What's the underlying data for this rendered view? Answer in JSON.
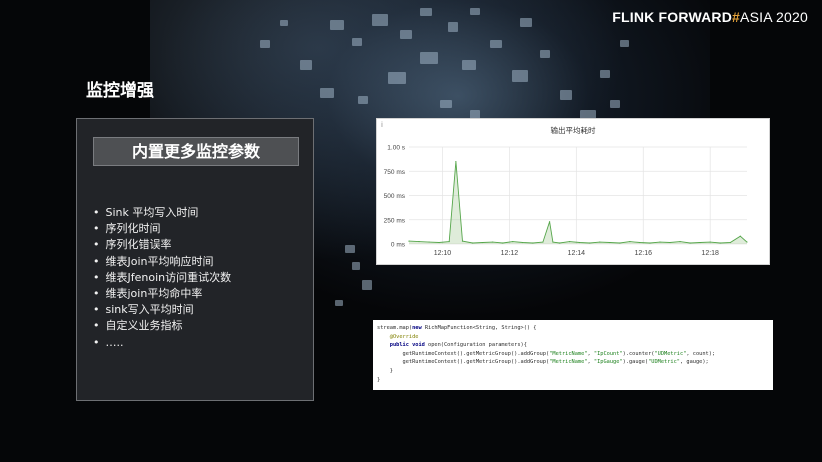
{
  "brand": {
    "name": "FLINK FORWARD",
    "hash": "#",
    "event": "ASIA 2020"
  },
  "section_title": "监控增强",
  "panel": {
    "header": "内置更多监控参数",
    "items": [
      "Sink 平均写入时间",
      "序列化时间",
      "序列化错误率",
      "维表Join平均响应时间",
      "维表Jfenoin访问重试次数",
      "维表join平均命中率",
      "sink写入平均时间",
      "自定义业务指标",
      "….."
    ]
  },
  "chart": {
    "info_icon": "i",
    "title": "输出平均耗时"
  },
  "chart_data": {
    "type": "area",
    "title": "输出平均耗时",
    "xlabel": "",
    "ylabel": "",
    "yticks": [
      "0 ms",
      "250 ms",
      "500 ms",
      "750 ms",
      "1.00 s"
    ],
    "xticks": [
      "12:10",
      "12:12",
      "12:14",
      "12:16",
      "12:18"
    ],
    "ylim": [
      0,
      1000
    ],
    "grid": true,
    "x": [
      "12:09.0",
      "12:09.3",
      "12:09.6",
      "12:09.9",
      "12:10.2",
      "12:10.4",
      "12:10.6",
      "12:10.9",
      "12:11.2",
      "12:11.5",
      "12:11.8",
      "12:12.1",
      "12:12.4",
      "12:12.7",
      "12:13.0",
      "12:13.2",
      "12:13.3",
      "12:13.5",
      "12:13.8",
      "12:14.1",
      "12:14.4",
      "12:14.7",
      "12:15.0",
      "12:15.3",
      "12:15.6",
      "12:15.9",
      "12:16.2",
      "12:16.5",
      "12:16.8",
      "12:17.1",
      "12:17.4",
      "12:17.7",
      "12:18.0",
      "12:18.3",
      "12:18.6",
      "12:18.9",
      "12:19.1"
    ],
    "values": [
      30,
      25,
      20,
      15,
      25,
      850,
      30,
      10,
      15,
      20,
      10,
      25,
      15,
      10,
      20,
      230,
      20,
      10,
      25,
      15,
      10,
      20,
      15,
      10,
      25,
      15,
      10,
      20,
      15,
      25,
      10,
      15,
      20,
      10,
      15,
      80,
      20
    ]
  },
  "code": {
    "lines": [
      [
        {
          "t": "stream.map(",
          "c": ""
        },
        {
          "t": "new ",
          "c": "kw"
        },
        {
          "t": "RichMapFunction<String, String>() {",
          "c": ""
        }
      ],
      [
        {
          "t": "    ",
          "c": ""
        },
        {
          "t": "@Override",
          "c": "ann"
        }
      ],
      [
        {
          "t": "    ",
          "c": ""
        },
        {
          "t": "public void ",
          "c": "kw"
        },
        {
          "t": "open(Configuration parameters){",
          "c": ""
        }
      ],
      [
        {
          "t": "        getRuntimeContext().getMetricGroup().addGroup(",
          "c": ""
        },
        {
          "t": "\"MetricName\"",
          "c": "str"
        },
        {
          "t": ", ",
          "c": ""
        },
        {
          "t": "\"IpCount\"",
          "c": "str"
        },
        {
          "t": ").counter(",
          "c": ""
        },
        {
          "t": "\"UDMetric\"",
          "c": "str"
        },
        {
          "t": ", count);",
          "c": ""
        }
      ],
      [
        {
          "t": "        getRuntimeContext().getMetricGroup().addGroup(",
          "c": ""
        },
        {
          "t": "\"MetricName\"",
          "c": "str"
        },
        {
          "t": ", ",
          "c": ""
        },
        {
          "t": "\"IpGauge\"",
          "c": "str"
        },
        {
          "t": ").gauge(",
          "c": ""
        },
        {
          "t": "\"UDMetric\"",
          "c": "str"
        },
        {
          "t": ", gauge);",
          "c": ""
        }
      ],
      [
        {
          "t": "    }",
          "c": ""
        }
      ],
      [
        {
          "t": "}",
          "c": ""
        }
      ]
    ]
  }
}
